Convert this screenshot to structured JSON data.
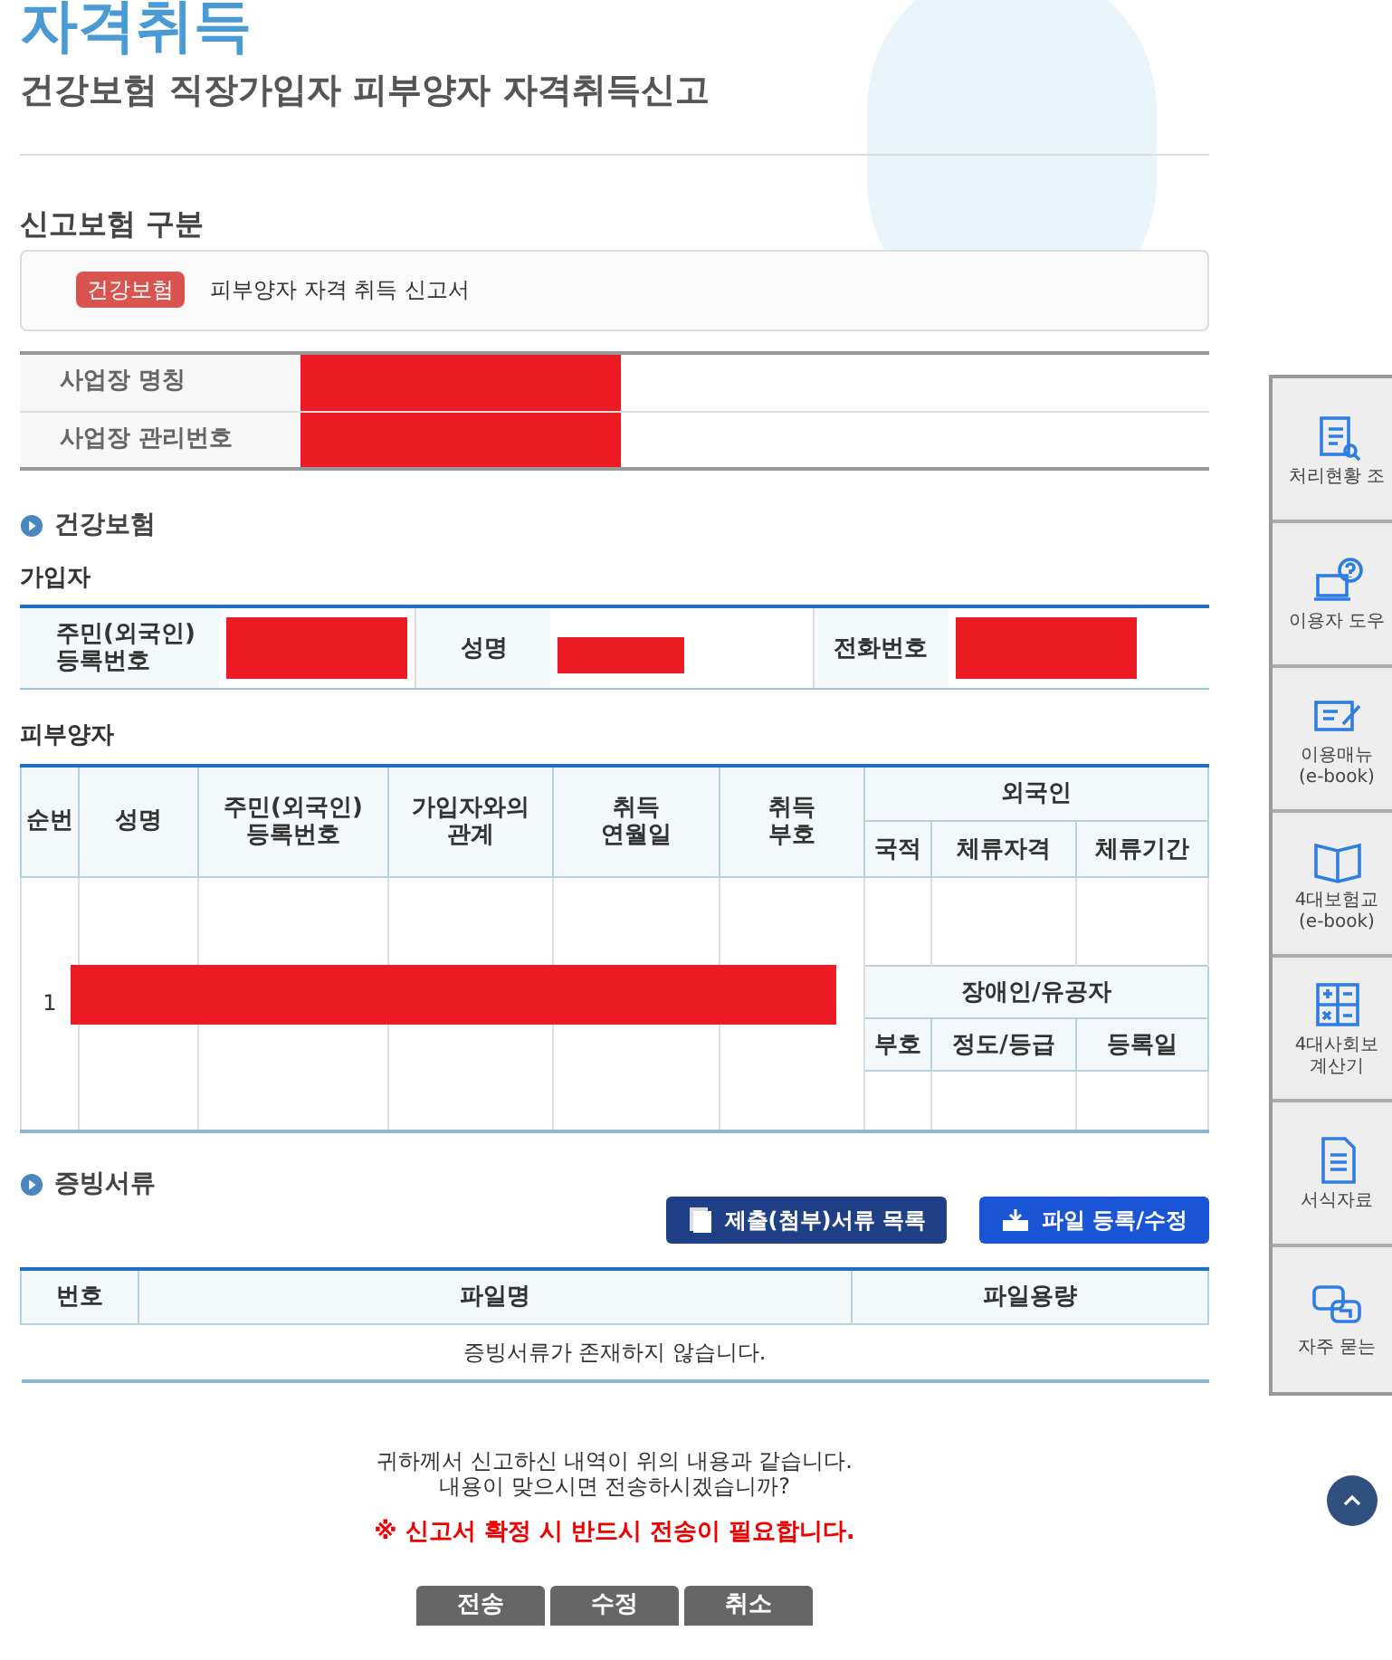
{
  "page": {
    "title": "자격취득",
    "subtitle": "건강보험 직장가입자 피부양자 자격취득신고"
  },
  "insurance_type": {
    "heading": "신고보험 구분",
    "badge": "건강보험",
    "form_name": "피부양자 자격 취득 신고서"
  },
  "workplace": [
    {
      "label": "사업장 명칭",
      "redacted": true
    },
    {
      "label": "사업장 관리번호",
      "redacted": true
    }
  ],
  "section_title": "건강보험",
  "subscriber": {
    "heading": "가입자",
    "fields": [
      {
        "label": "주민(외국인)\n등록번호",
        "redacted": true
      },
      {
        "label": "성명",
        "redacted": true
      },
      {
        "label": "전화번호",
        "redacted": true
      }
    ]
  },
  "dependents": {
    "heading": "피부양자",
    "columns": [
      "순번",
      "성명",
      "주민(외국인)\n등록번호",
      "가입자와의\n관계",
      "취득\n연월일",
      "취득\n부호"
    ],
    "foreigner": {
      "title": "외국인",
      "columns": [
        "국적",
        "체류자격",
        "체류기간"
      ]
    },
    "disabled": {
      "title": "장애인/유공자",
      "columns": [
        "부호",
        "정도/등급",
        "등록일"
      ]
    },
    "rows": [
      {
        "number": "1",
        "redacted": true
      }
    ]
  },
  "documents": {
    "heading": "증빙서류",
    "buttons": [
      {
        "label": "제출(첨부)서류 목록",
        "kind": "list"
      },
      {
        "label": "파일 등록/수정",
        "kind": "upload"
      }
    ],
    "columns": [
      "번호",
      "파일명",
      "파일용량"
    ],
    "empty": "증빙서류가 존재하지 않습니다."
  },
  "confirm": {
    "lines": [
      "귀하께서 신고하신 내역이 위의 내용과 같습니다.",
      "내용이 맞으시면 전송하시겠습니까?"
    ],
    "warning": "※ 신고서 확정 시 반드시 전송이 필요합니다.",
    "buttons": [
      "전송",
      "수정",
      "취소"
    ]
  },
  "quick_menu": [
    {
      "label": "처리현황 조",
      "kind": "search"
    },
    {
      "label": "이용자 도우",
      "kind": "help"
    },
    {
      "label": "이용매뉴\n(e-book)",
      "kind": "edit"
    },
    {
      "label": "4대보험교\n(e-book)",
      "kind": "book"
    },
    {
      "label": "4대사회보\n계산기",
      "kind": "calc"
    },
    {
      "label": "서식자료",
      "kind": "doc"
    },
    {
      "label": "자주 묻는",
      "kind": "chat"
    }
  ]
}
